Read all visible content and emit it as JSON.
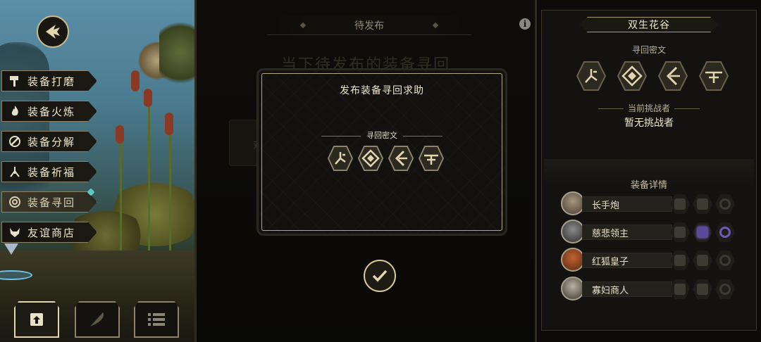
{
  "left_menu": {
    "items": [
      {
        "label": "装备打磨",
        "icon": "hammer-icon"
      },
      {
        "label": "装备火炼",
        "icon": "flame-icon"
      },
      {
        "label": "装备分解",
        "icon": "disassemble-icon"
      },
      {
        "label": "装备祈福",
        "icon": "pray-icon"
      },
      {
        "label": "装备寻回",
        "icon": "target-icon",
        "active": true
      },
      {
        "label": "友谊商店",
        "icon": "fox-icon"
      }
    ],
    "bottom_tabs": [
      {
        "icon": "upload-icon",
        "active": true
      },
      {
        "icon": "feather-icon",
        "active": false
      },
      {
        "icon": "list-icon",
        "active": false
      }
    ]
  },
  "middle": {
    "tab_title": "待发布",
    "info_label": "i",
    "background_heading": "当下待发布的装备寻回",
    "background_card_text": "双",
    "dialog": {
      "title": "发布装备寻回求助",
      "cipher_label": "寻回密文",
      "runes": [
        "rune-fork-icon",
        "rune-eye-icon",
        "rune-axe-icon",
        "rune-cross-icon"
      ]
    }
  },
  "right": {
    "location": "双生花谷",
    "cipher_label": "寻回密文",
    "runes": [
      "rune-fork-icon",
      "rune-eye-icon",
      "rune-axe-icon",
      "rune-cross-icon"
    ],
    "challenger_label": "当前挑战者",
    "challenger_value": "暂无挑战者",
    "detail_label": "装备详情",
    "heroes": [
      {
        "name": "长手炮",
        "avatar": "hero-longhand-cannon-avatar",
        "slots": [
          "weapon",
          "armor",
          "ring"
        ]
      },
      {
        "name": "慈悲领主",
        "avatar": "hero-mercy-lord-avatar",
        "slots": [
          "weapon",
          "armor-purple",
          "ring-purple"
        ]
      },
      {
        "name": "红狐皇子",
        "avatar": "hero-red-fox-prince-avatar",
        "slots": [
          "weapon",
          "armor",
          "ring"
        ]
      },
      {
        "name": "寡妇商人",
        "avatar": "hero-widow-merchant-avatar",
        "slots": [
          "weapon",
          "armor",
          "ring"
        ]
      }
    ]
  },
  "colors": {
    "gold_border": "#c9b98a",
    "panel_bg": "#141210",
    "text": "#efe6cc",
    "accent_purple": "#6b5ab8"
  }
}
